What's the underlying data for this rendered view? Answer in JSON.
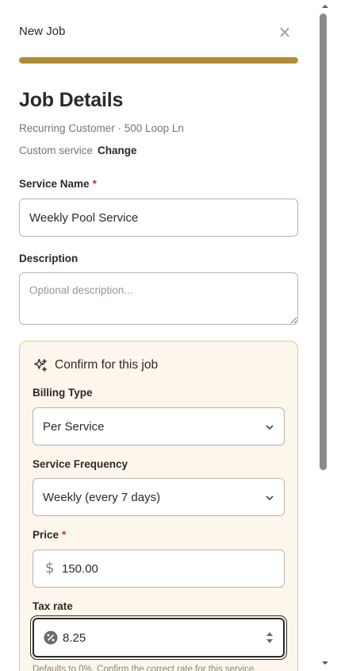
{
  "header": {
    "title": "New Job",
    "close_symbol": "×"
  },
  "progress": {
    "fraction": 1.0
  },
  "page": {
    "title": "Job Details",
    "subtitle": "Recurring Customer · 500 Loop Ln",
    "service_type": "Custom service",
    "change_label": "Change"
  },
  "service_name": {
    "label": "Service Name",
    "required_mark": "*",
    "value": "Weekly Pool Service"
  },
  "description": {
    "label": "Description",
    "placeholder": "Optional description..."
  },
  "confirm": {
    "title": "Confirm for this job",
    "billing_type": {
      "label": "Billing Type",
      "value": "Per Service"
    },
    "frequency": {
      "label": "Service Frequency",
      "value": "Weekly (every 7 days)"
    },
    "price": {
      "label": "Price",
      "required_mark": "*",
      "currency": "$",
      "value": "150.00"
    },
    "tax_rate": {
      "label": "Tax rate",
      "value": "8.25"
    },
    "helper": "Defaults to 0%. Confirm the correct rate for this service."
  },
  "colors": {
    "accent": "#b08d35",
    "confirm_bg": "#fdf6ec",
    "confirm_border": "#e7c879",
    "required": "#c0392b"
  },
  "icons": {
    "close": "close-icon",
    "sparkle": "sparkle-icon",
    "chevron": "chevron-down-icon",
    "dollar": "dollar-icon",
    "percent": "percent-icon"
  }
}
